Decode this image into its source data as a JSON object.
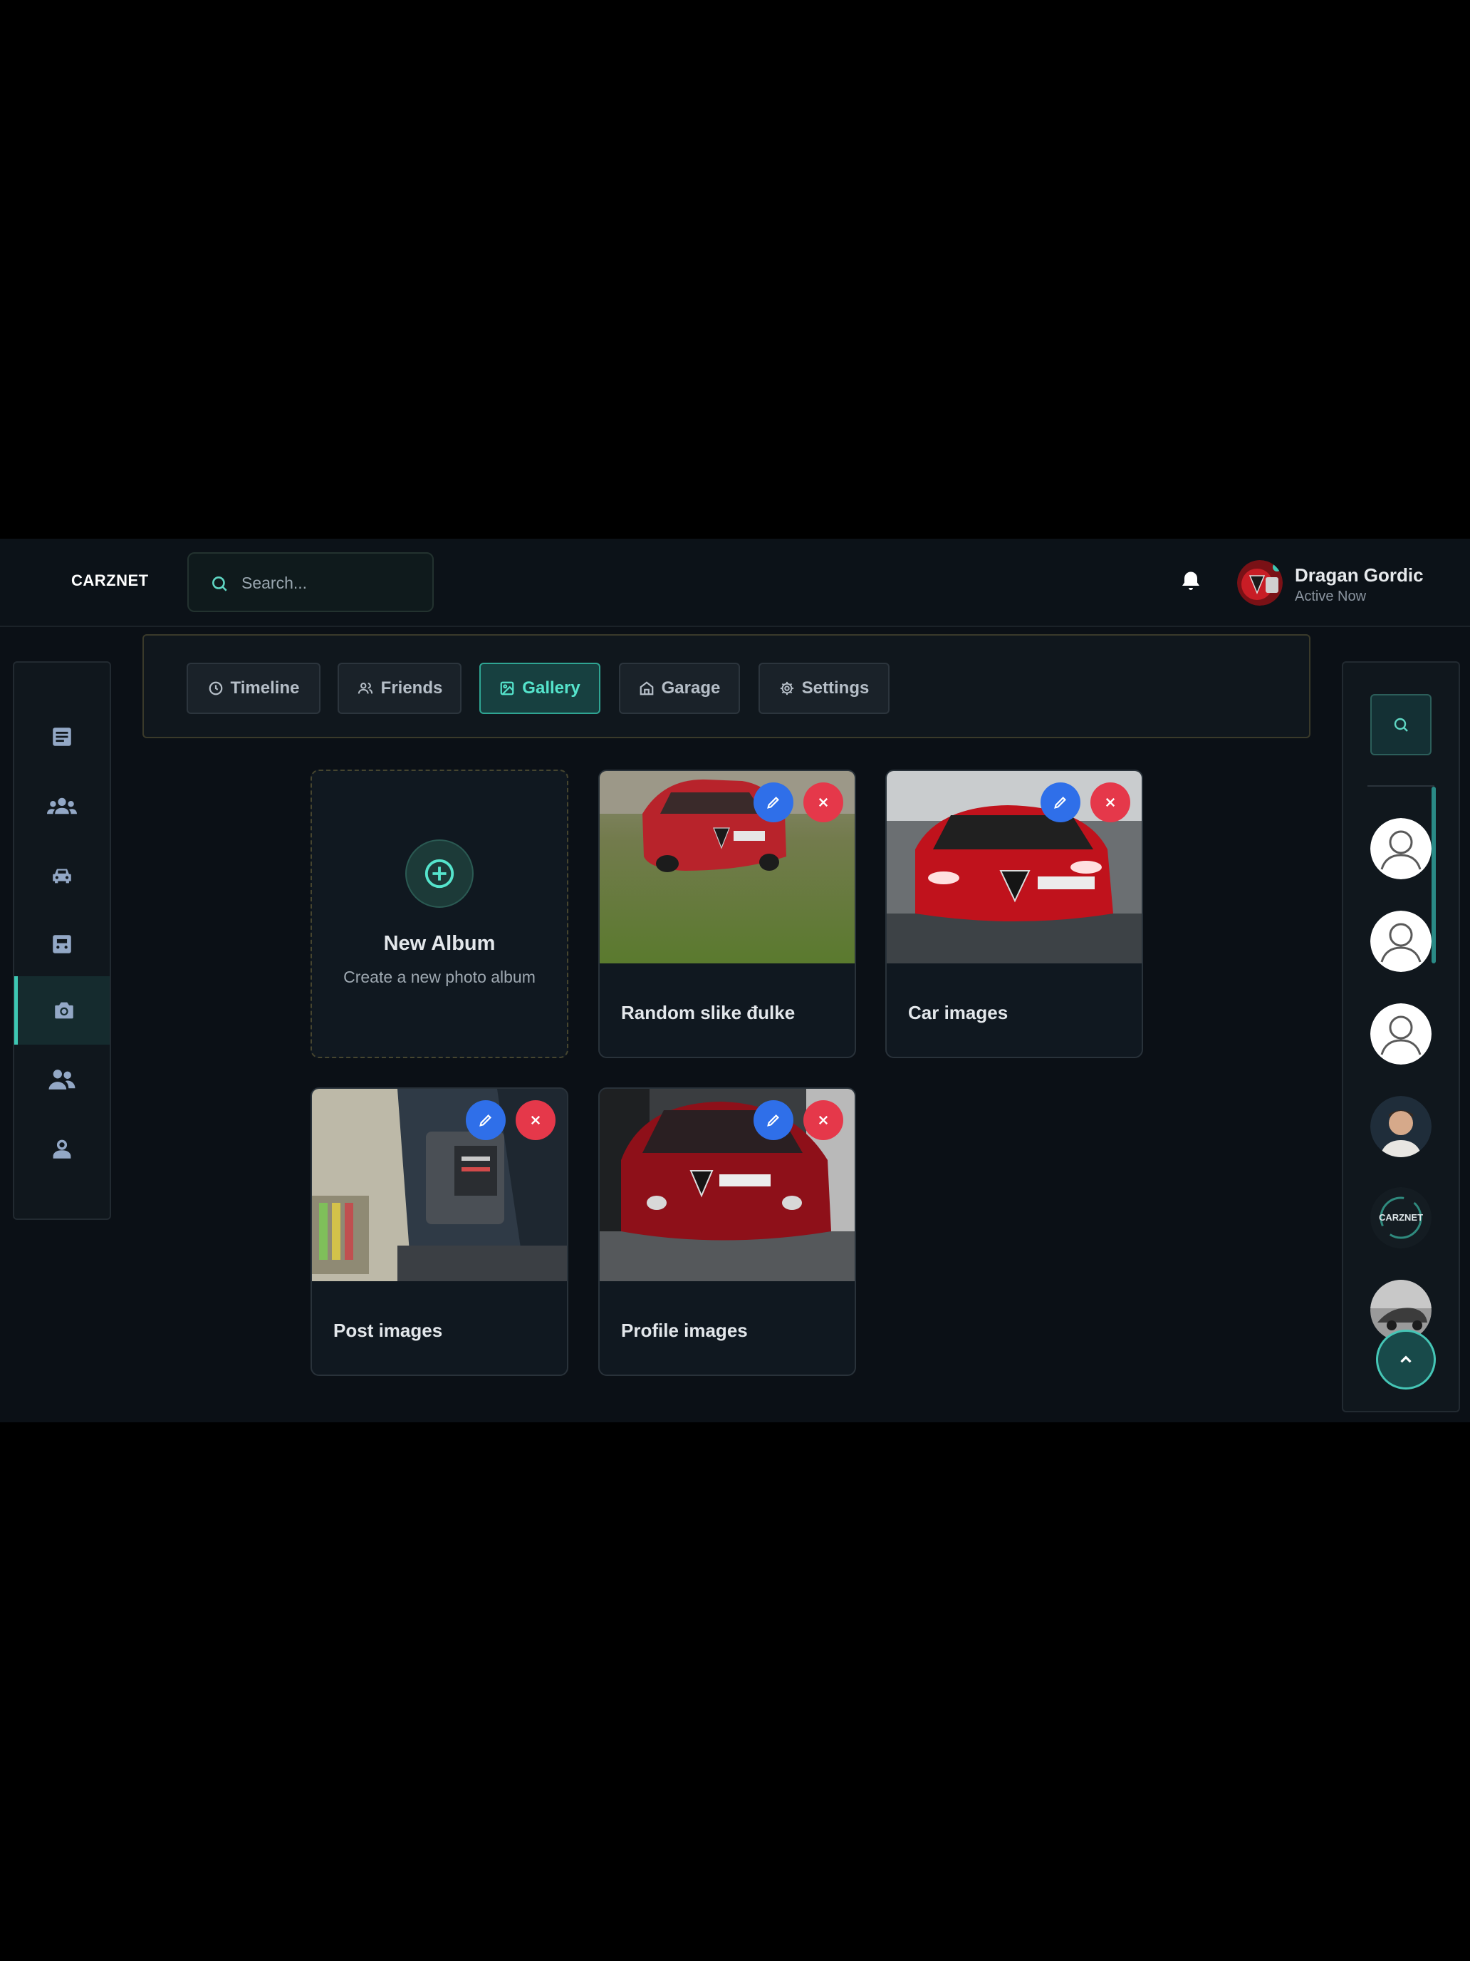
{
  "header": {
    "brand": "CARZNET",
    "search_placeholder": "Search...",
    "user_name": "Dragan Gordic",
    "user_status": "Active Now"
  },
  "sidebar": {
    "items": [
      {
        "name": "posts",
        "icon": "article-icon",
        "active": false
      },
      {
        "name": "groups",
        "icon": "groups-icon",
        "active": false
      },
      {
        "name": "cars",
        "icon": "car-icon",
        "active": false
      },
      {
        "name": "garage",
        "icon": "car-front-icon",
        "active": false
      },
      {
        "name": "gallery",
        "icon": "camera-icon",
        "active": true
      },
      {
        "name": "friends",
        "icon": "people-icon",
        "active": false
      },
      {
        "name": "profile",
        "icon": "person-icon",
        "active": false
      }
    ]
  },
  "tabs": [
    {
      "label": "Timeline",
      "icon": "clock-icon",
      "active": false
    },
    {
      "label": "Friends",
      "icon": "users-icon",
      "active": false
    },
    {
      "label": "Gallery",
      "icon": "image-icon",
      "active": true
    },
    {
      "label": "Garage",
      "icon": "home-icon",
      "active": false
    },
    {
      "label": "Settings",
      "icon": "gear-icon",
      "active": false
    }
  ],
  "new_album": {
    "title": "New Album",
    "subtitle": "Create a new photo album"
  },
  "albums": [
    {
      "title": "Random slike đulke"
    },
    {
      "title": "Car images"
    },
    {
      "title": "Post images"
    },
    {
      "title": "Profile images"
    }
  ],
  "right_sidebar": {
    "friends_logo_text": "CARZNET"
  },
  "colors": {
    "accent": "#3ec7b3",
    "edit": "#2f6fe9",
    "delete": "#e5384a",
    "background": "#0b1016"
  }
}
